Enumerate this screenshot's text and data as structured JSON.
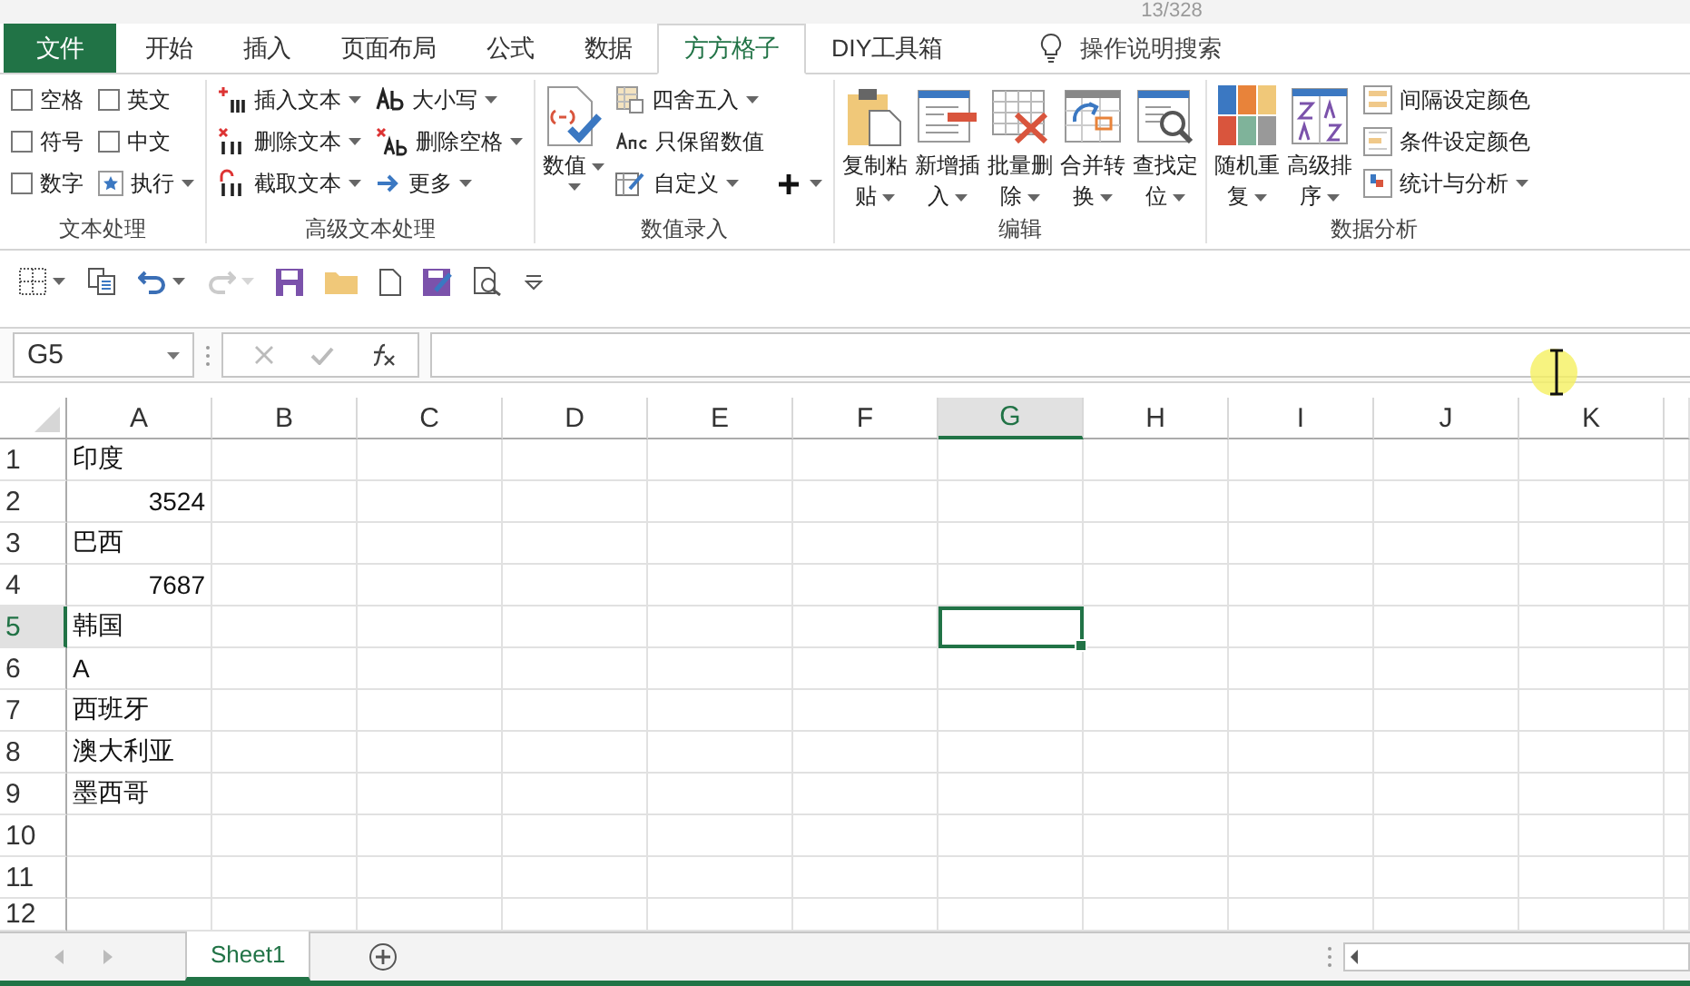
{
  "page_counter": "13/328",
  "tabs": [
    {
      "label": "文件",
      "kind": "file",
      "selected": false
    },
    {
      "label": "开始",
      "kind": "tab",
      "selected": false
    },
    {
      "label": "插入",
      "kind": "tab",
      "selected": false
    },
    {
      "label": "页面布局",
      "kind": "tab",
      "selected": false
    },
    {
      "label": "公式",
      "kind": "tab",
      "selected": false
    },
    {
      "label": "数据",
      "kind": "tab",
      "selected": false
    },
    {
      "label": "方方格子",
      "kind": "tab",
      "selected": true
    },
    {
      "label": "DIY工具箱",
      "kind": "tab",
      "selected": false
    }
  ],
  "tell_me": "操作说明搜索",
  "ribbon": {
    "groups": [
      {
        "label": "文本处理",
        "columns": [
          [
            {
              "kind": "checkbox",
              "label": "空格",
              "checked": false
            },
            {
              "kind": "checkbox",
              "label": "符号",
              "checked": false
            },
            {
              "kind": "checkbox",
              "label": "数字",
              "checked": false
            }
          ],
          [
            {
              "kind": "checkbox",
              "label": "英文",
              "checked": false
            },
            {
              "kind": "checkbox",
              "label": "中文",
              "checked": false
            },
            {
              "kind": "small",
              "label": "执行",
              "dropdown": true
            }
          ]
        ]
      },
      {
        "label": "高级文本处理",
        "columns": [
          [
            {
              "kind": "small",
              "label": "插入文本",
              "dropdown": true
            },
            {
              "kind": "small",
              "label": "删除文本",
              "dropdown": true
            },
            {
              "kind": "small",
              "label": "截取文本",
              "dropdown": true
            }
          ],
          [
            {
              "kind": "small",
              "label": "大小写",
              "dropdown": true
            },
            {
              "kind": "small",
              "label": "删除空格",
              "dropdown": true
            },
            {
              "kind": "small",
              "label": "更多",
              "dropdown": true
            }
          ]
        ]
      },
      {
        "label": "数值录入",
        "columns": [
          [
            {
              "kind": "large",
              "lines": [
                "数值"
              ],
              "dropdown": true
            }
          ],
          [
            {
              "kind": "small",
              "label": "四舍五入",
              "dropdown": true
            },
            {
              "kind": "small",
              "label": "只保留数值",
              "dropdown": false
            },
            {
              "kind": "small",
              "label": "自定义",
              "dropdown": true
            }
          ],
          [
            {
              "kind": "icon",
              "dropdown": true
            }
          ]
        ]
      },
      {
        "label": "编辑",
        "columns": [
          [
            {
              "kind": "large",
              "lines": [
                "复制粘",
                "贴"
              ],
              "dropdown": true
            }
          ],
          [
            {
              "kind": "large",
              "lines": [
                "新增插",
                "入"
              ],
              "dropdown": true
            }
          ],
          [
            {
              "kind": "large",
              "lines": [
                "批量删",
                "除"
              ],
              "dropdown": true
            }
          ],
          [
            {
              "kind": "large",
              "lines": [
                "合并转",
                "换"
              ],
              "dropdown": true
            }
          ],
          [
            {
              "kind": "large",
              "lines": [
                "查找定",
                "位"
              ],
              "dropdown": true
            }
          ]
        ]
      },
      {
        "label": "数据分析",
        "columns": [
          [
            {
              "kind": "large",
              "lines": [
                "随机重",
                "复"
              ],
              "dropdown": true
            }
          ],
          [
            {
              "kind": "large",
              "lines": [
                "高级排",
                "序"
              ],
              "dropdown": true
            }
          ],
          [
            {
              "kind": "small",
              "label": "间隔设定颜色",
              "dropdown": false
            },
            {
              "kind": "small",
              "label": "条件设定颜色",
              "dropdown": false
            },
            {
              "kind": "small",
              "label": "统计与分析",
              "dropdown": true
            }
          ]
        ]
      }
    ]
  },
  "quick_access": [
    {
      "dropdown": true,
      "disabled": false
    },
    {
      "dropdown": false,
      "disabled": false
    },
    {
      "dropdown": true,
      "disabled": false
    },
    {
      "dropdown": true,
      "disabled": true
    },
    {
      "dropdown": false,
      "disabled": false
    },
    {
      "dropdown": false,
      "disabled": false
    },
    {
      "dropdown": false,
      "disabled": false
    },
    {
      "dropdown": false,
      "disabled": false
    },
    {
      "dropdown": false,
      "disabled": false
    },
    {
      "dropdown": false,
      "disabled": false
    }
  ],
  "formula_bar": {
    "name_box": "G5"
  },
  "grid": {
    "columns": [
      {
        "label": "A",
        "selected": false
      },
      {
        "label": "B",
        "selected": false
      },
      {
        "label": "C",
        "selected": false
      },
      {
        "label": "D",
        "selected": false
      },
      {
        "label": "E",
        "selected": false
      },
      {
        "label": "F",
        "selected": false
      },
      {
        "label": "G",
        "selected": true
      },
      {
        "label": "H",
        "selected": false
      },
      {
        "label": "I",
        "selected": false
      },
      {
        "label": "J",
        "selected": false
      },
      {
        "label": "K",
        "selected": false
      }
    ],
    "rows": [
      {
        "number": "1",
        "selected": false,
        "cell_a": {
          "text": "印度",
          "kind": "text"
        }
      },
      {
        "number": "2",
        "selected": false,
        "cell_a": {
          "text": "3524",
          "kind": "number"
        }
      },
      {
        "number": "3",
        "selected": false,
        "cell_a": {
          "text": "巴西",
          "kind": "text"
        }
      },
      {
        "number": "4",
        "selected": false,
        "cell_a": {
          "text": "7687",
          "kind": "number"
        }
      },
      {
        "number": "5",
        "selected": true,
        "cell_a": {
          "text": "韩国",
          "kind": "text"
        }
      },
      {
        "number": "6",
        "selected": false,
        "cell_a": {
          "text": "A",
          "kind": "text"
        }
      },
      {
        "number": "7",
        "selected": false,
        "cell_a": {
          "text": "西班牙",
          "kind": "text"
        }
      },
      {
        "number": "8",
        "selected": false,
        "cell_a": {
          "text": "澳大利亚",
          "kind": "text"
        }
      },
      {
        "number": "9",
        "selected": false,
        "cell_a": {
          "text": "墨西哥",
          "kind": "text"
        }
      },
      {
        "number": "10",
        "selected": false
      },
      {
        "number": "11",
        "selected": false
      },
      {
        "number": "12",
        "selected": false
      }
    ]
  },
  "sheet_tabs": [
    {
      "label": "Sheet1",
      "selected": true
    }
  ]
}
